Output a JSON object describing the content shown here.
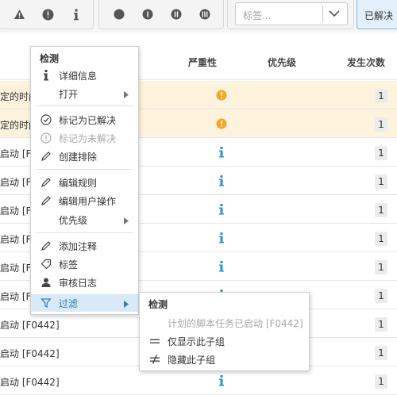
{
  "toolbar": {
    "tag_placeholder": "标签...",
    "resolved_label": "已解决"
  },
  "table": {
    "columns": [
      "严重性",
      "优先级",
      "发生次数"
    ],
    "rows": [
      {
        "text": "定的时间",
        "severity": "warning",
        "count": "1",
        "highlight": true
      },
      {
        "text": "定的时间",
        "severity": "warning",
        "count": "1",
        "highlight": true
      },
      {
        "text": "启动 [F0",
        "severity": "info",
        "count": "1",
        "highlight": false
      },
      {
        "text": "启动 [FC",
        "severity": "info",
        "count": "1",
        "highlight": false
      },
      {
        "text": "启动 [F0",
        "severity": "info",
        "count": "1",
        "highlight": false
      },
      {
        "text": "启动 [F0",
        "severity": "info",
        "count": "1",
        "highlight": false
      },
      {
        "text": "启动 [F0",
        "severity": "info",
        "count": "1",
        "highlight": false
      },
      {
        "text": "启动 [F0",
        "severity": "info",
        "count": "1",
        "highlight": false
      },
      {
        "text": "启动 [F0442]",
        "severity": "info",
        "count": "1",
        "highlight": false
      },
      {
        "text": "启动 [F0442]",
        "severity": "info",
        "count": "1",
        "highlight": false
      },
      {
        "text": "启动 [F0442]",
        "severity": "info",
        "count": "1",
        "highlight": false
      }
    ]
  },
  "context_menu": {
    "title": "检测",
    "items": [
      {
        "label": "详细信息",
        "icon": "info-icon"
      },
      {
        "label": "打开",
        "icon": "",
        "submenu": true
      },
      {
        "label": "标记为已解决",
        "icon": "check-circle-icon"
      },
      {
        "label": "标记为未解决",
        "icon": "exclamation-circle-icon",
        "disabled": true
      },
      {
        "label": "创建排除",
        "icon": "pencil-icon"
      },
      {
        "label": "编辑规则",
        "icon": "pencil-icon"
      },
      {
        "label": "编辑用户操作",
        "icon": "pencil-icon"
      },
      {
        "label": "优先级",
        "icon": "",
        "submenu": true
      },
      {
        "label": "添加注释",
        "icon": "pencil-icon"
      },
      {
        "label": "标签",
        "icon": "tag-icon"
      },
      {
        "label": "审核日志",
        "icon": "user-icon"
      },
      {
        "label": "过滤",
        "icon": "filter-icon",
        "submenu": true,
        "active": true
      }
    ]
  },
  "submenu": {
    "title": "检测",
    "items": [
      {
        "label": "计划的脚本任务已启动 [F0442]",
        "disabled": true
      },
      {
        "label": "仅显示此子组",
        "icon": "equals-icon"
      },
      {
        "label": "隐藏此子组",
        "icon": "not-equals-icon"
      }
    ]
  },
  "colors": {
    "accent": "#2d7fc1",
    "warning": "#f5a623",
    "info": "#2b8fd6",
    "highlight_row": "#fdf2dc"
  }
}
